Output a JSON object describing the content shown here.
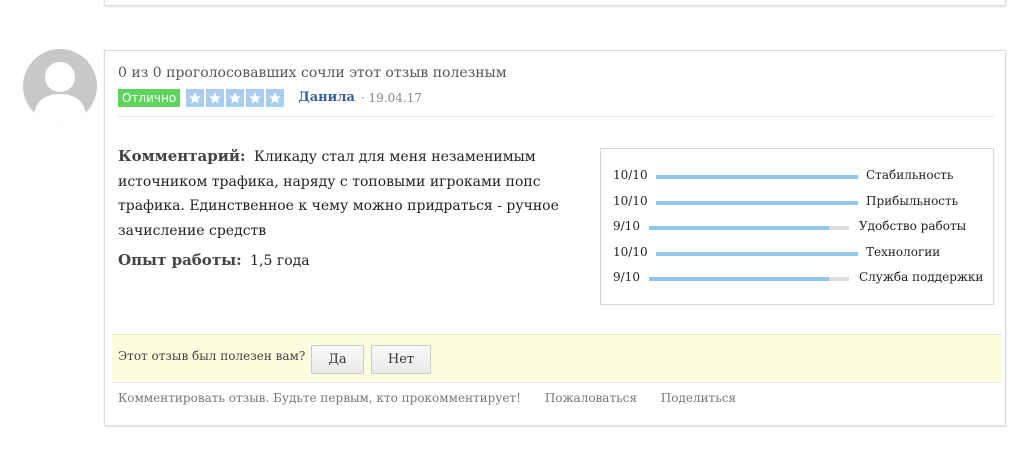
{
  "review": {
    "votes_text": "0 из 0 проголосовавших сочли этот отзыв полезным",
    "badge": "Отлично",
    "stars": 5,
    "author": "Данила",
    "date": "· 19.04.17",
    "comment_label": "Комментарий:",
    "comment_text": "Кликаду стал для меня незаменимым источником трафика, наряду с топовыми игроками попс трафика. Единственное к чему можно придраться - ручное зачисление средств",
    "experience_label": "Опыт работы:",
    "experience_value": "1,5 года"
  },
  "ratings": [
    {
      "score": "10/10",
      "label": "Стабильность",
      "value": 1.0
    },
    {
      "score": "10/10",
      "label": "Прибыльность",
      "value": 1.0
    },
    {
      "score": "9/10",
      "label": "Удобство работы",
      "value": 0.9
    },
    {
      "score": "10/10",
      "label": "Технологии",
      "value": 1.0
    },
    {
      "score": "9/10",
      "label": "Служба поддержки",
      "value": 0.9
    }
  ],
  "helpful": {
    "question": "Этот отзыв был полезен вам?",
    "yes": "Да",
    "no": "Нет"
  },
  "footer": {
    "comment_link": "Комментировать отзыв. Будьте первым, кто прокомментирует!",
    "report_link": "Пожаловаться",
    "share_link": "Поделиться"
  },
  "colors": {
    "badge": "#5ed35e",
    "star": "#a9cef0",
    "rating_fill": "#92c5ea",
    "author": "#3b5d9a",
    "helpful_bg": "#fdfde0"
  }
}
